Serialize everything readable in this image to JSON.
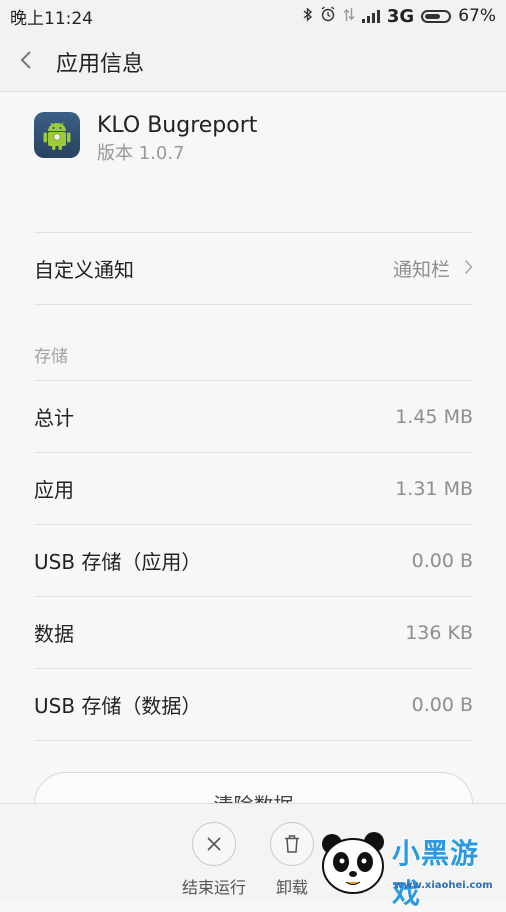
{
  "status_bar": {
    "time": "晚上11:24",
    "network": "3G",
    "battery": "67%",
    "battery_level": 0.67,
    "icons": [
      "bluetooth-icon",
      "alarm-icon",
      "data-transfer-icon",
      "signal-icon",
      "battery-icon"
    ]
  },
  "header": {
    "title": "应用信息",
    "back_icon": "chevron-left-icon"
  },
  "app": {
    "name": "KLO Bugreport",
    "version": "版本 1.0.7",
    "icon": "android-app-icon"
  },
  "notification": {
    "label": "自定义通知",
    "value": "通知栏"
  },
  "storage": {
    "section_title": "存储",
    "rows": [
      {
        "label": "总计",
        "value": "1.45 MB"
      },
      {
        "label": "应用",
        "value": "1.31 MB"
      },
      {
        "label": "USB 存储（应用）",
        "value": "0.00 B"
      },
      {
        "label": "数据",
        "value": "136 KB"
      },
      {
        "label": "USB 存储（数据）",
        "value": "0.00 B"
      }
    ]
  },
  "clear_data_label": "清除数据",
  "bottom_actions": {
    "force_stop": "结束运行",
    "uninstall": "卸载"
  },
  "watermark": {
    "text": "小黑游戏",
    "url": "www.xiaohei.com"
  },
  "colors": {
    "background": "#f7f7f7",
    "text_primary": "#222222",
    "text_secondary": "#8e8e8e",
    "watermark_blue": "#2d9ae0"
  }
}
